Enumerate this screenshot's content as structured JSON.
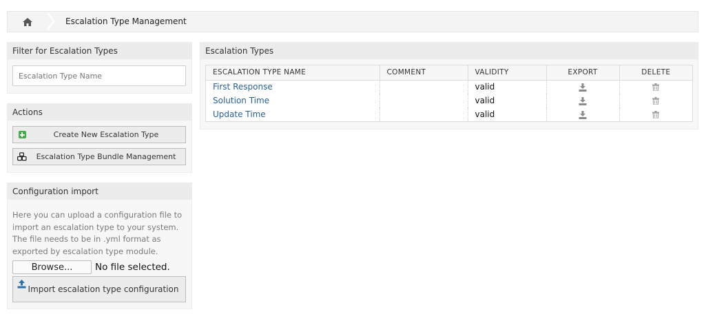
{
  "breadcrumb": {
    "home_icon": "home-icon",
    "title": "Escalation Type Management"
  },
  "filter": {
    "header": "Filter for Escalation Types",
    "placeholder": "Escalation Type Name"
  },
  "actions": {
    "header": "Actions",
    "create_label": "Create New Escalation Type",
    "create_icon": "plus-square-icon",
    "bundle_label": "Escalation Type Bundle Management",
    "bundle_icon": "cubes-icon"
  },
  "config_import": {
    "header": "Configuration import",
    "description": "Here you can upload a configuration file to import an escalation type to your system. The file needs to be in .yml format as exported by escalation type module.",
    "browse_label": "Browse...",
    "file_status": "No file selected.",
    "import_label": "Import escalation type configuration",
    "import_icon": "upload-icon"
  },
  "main": {
    "header": "Escalation Types",
    "columns": [
      "ESCALATION TYPE NAME",
      "COMMENT",
      "VALIDITY",
      "EXPORT",
      "DELETE"
    ],
    "rows": [
      {
        "name": "First Response",
        "comment": "",
        "validity": "valid"
      },
      {
        "name": "Solution Time",
        "comment": "",
        "validity": "valid"
      },
      {
        "name": "Update Time",
        "comment": "",
        "validity": "valid"
      }
    ],
    "export_icon": "download-icon",
    "delete_icon": "trash-icon"
  },
  "colors": {
    "link": "#2b5f98",
    "add_green": "#3fae49",
    "upload_blue": "#2f6fa7"
  }
}
